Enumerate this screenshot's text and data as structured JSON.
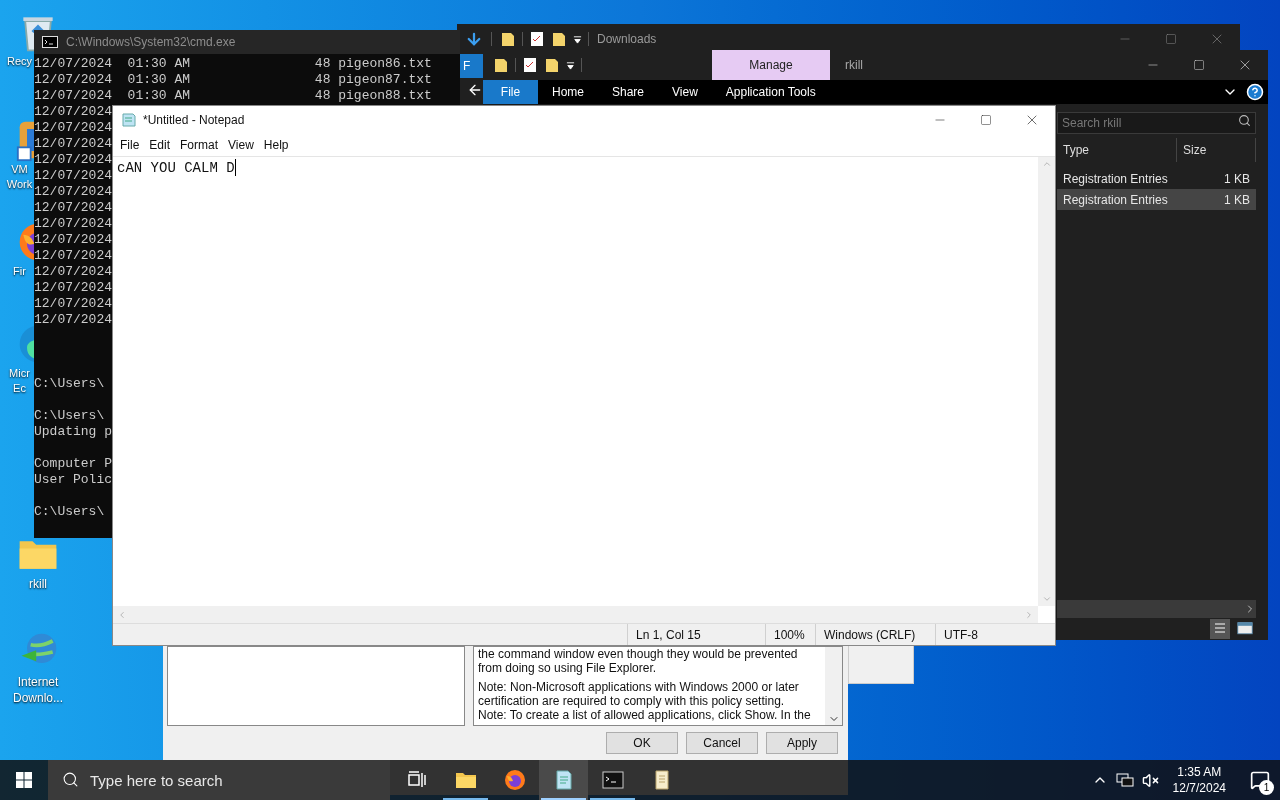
{
  "desktop_icons": [
    {
      "kind": "recycle-bin",
      "label": "Recy"
    },
    {
      "kind": "vm",
      "label": "VM Work"
    },
    {
      "kind": "browser-fox",
      "label": "Fir"
    },
    {
      "kind": "browser-edge",
      "label": "Micr Ec"
    },
    {
      "kind": "folder",
      "label": "rkill"
    },
    {
      "kind": "download-globe",
      "label": "Internet Downlo..."
    }
  ],
  "cmd": {
    "title": "C:\\Windows\\System32\\cmd.exe",
    "blocks": [
      [
        "12/07/2024  01:30 AM                48 pigeon86.txt",
        "12/07/2024  01:30 AM                48 pigeon87.txt",
        "12/07/2024  01:30 AM                48 pigeon88.txt",
        "12/07/2024",
        "12/07/2024",
        "12/07/2024",
        "12/07/2024",
        "12/07/2024",
        "12/07/2024",
        "12/07/2024",
        "12/07/2024",
        "12/07/2024",
        "12/07/2024",
        "12/07/2024",
        "12/07/2024",
        "12/07/2024",
        "12/07/2024"
      ],
      [
        "C:\\Users\\"
      ],
      [
        "C:\\Users\\",
        "Updating p"
      ],
      [
        "Computer P",
        "User Polic"
      ],
      [
        "C:\\Users\\"
      ]
    ]
  },
  "downloads_window": {
    "title": "Downloads",
    "ribbon_tab": "F"
  },
  "rkill_window": {
    "context_tab": "Manage",
    "title": "rkill",
    "ribbon_tabs": [
      {
        "label": "File",
        "selected": true
      },
      {
        "label": "Home",
        "selected": false
      },
      {
        "label": "Share",
        "selected": false
      },
      {
        "label": "View",
        "selected": false
      },
      {
        "label": "Application Tools",
        "selected": false
      }
    ],
    "search": {
      "placeholder": "Search rkill"
    },
    "columns": [
      "Type",
      "Size"
    ],
    "rows": [
      {
        "type": "Registration Entries",
        "size": "1 KB",
        "selected": false
      },
      {
        "type": "Registration Entries",
        "size": "1 KB",
        "selected": true
      }
    ]
  },
  "policy_dialog": {
    "help_paragraphs": [
      "the command window even though they would be prevented from doing so using File Explorer.",
      "Note: Non-Microsoft applications with Windows 2000 or later certification are required to comply with this policy setting.\nNote: To create a list of allowed applications, click Show.  In the"
    ],
    "buttons": [
      "OK",
      "Cancel",
      "Apply"
    ]
  },
  "notepad": {
    "title": "*Untitled - Notepad",
    "menu": [
      "File",
      "Edit",
      "Format",
      "View",
      "Help"
    ],
    "text": "cAN YOU CALM D",
    "status": [
      "Ln 1, Col 15",
      "100%",
      "Windows (CRLF)",
      "UTF-8"
    ]
  },
  "taskbar": {
    "search_placeholder": "Type here to search",
    "apps": [
      {
        "kind": "task-view",
        "running": false,
        "active": false
      },
      {
        "kind": "folder",
        "running": true,
        "active": false
      },
      {
        "kind": "browser-fox",
        "running": false,
        "active": false
      },
      {
        "kind": "notepad",
        "running": true,
        "active": true
      },
      {
        "kind": "console",
        "running": true,
        "active": false
      },
      {
        "kind": "document",
        "running": false,
        "active": false
      }
    ],
    "time": "1:35 AM",
    "date": "12/7/2024",
    "notification_count": "1"
  }
}
